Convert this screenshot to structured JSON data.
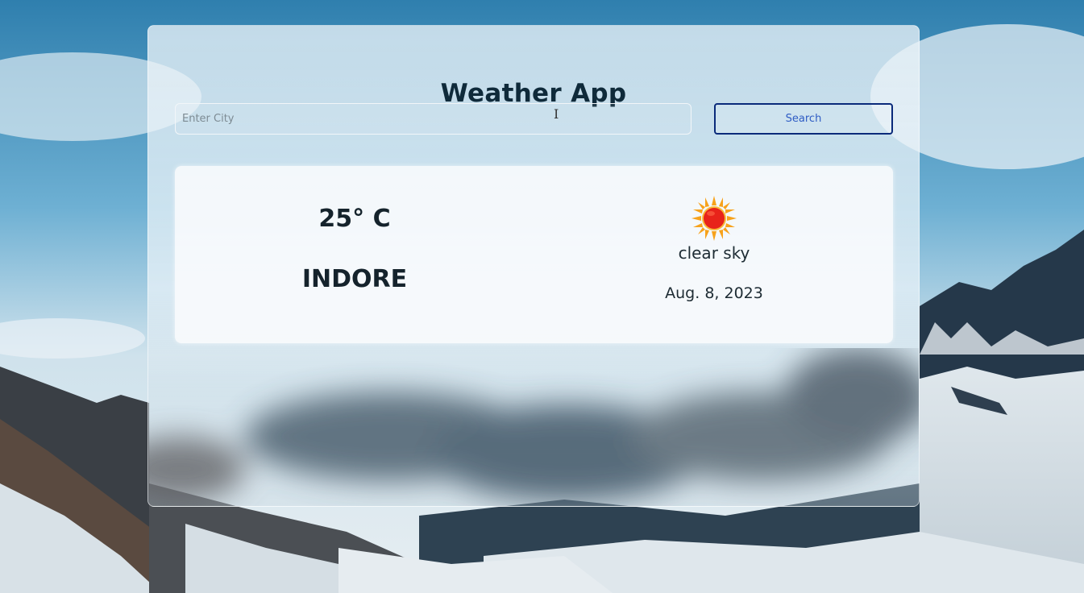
{
  "app": {
    "title": "Weather App"
  },
  "search": {
    "placeholder": "Enter City",
    "value": "",
    "button_label": "Search"
  },
  "weather": {
    "temperature": "25° C",
    "city": "INDORE",
    "condition_icon": "sun-icon",
    "description": "clear sky",
    "date": "Aug. 8, 2023"
  },
  "colors": {
    "title_text": "#0f2a3a",
    "button_border": "#0a2a7a",
    "button_text": "#2e5cc4",
    "card_background": "#fcfdfe",
    "sun_core": "#e8231a",
    "sun_rays": "#f7a21b"
  }
}
